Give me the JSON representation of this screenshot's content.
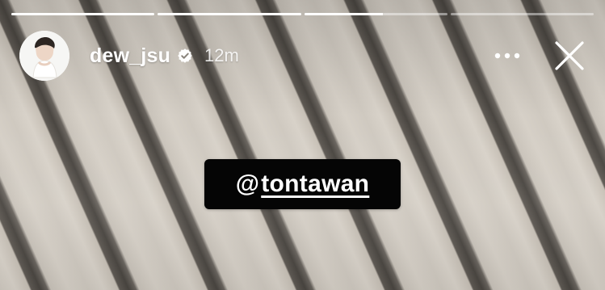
{
  "progress": [
    {
      "state": "viewed",
      "fill": 1.0
    },
    {
      "state": "viewed",
      "fill": 1.0
    },
    {
      "state": "current",
      "fill": 0.55
    },
    {
      "state": "upcoming",
      "fill": 0.0
    }
  ],
  "header": {
    "username": "dew_jsu",
    "verified_icon": "verified-badge-icon",
    "time": "12m",
    "more_icon": "more-options-icon",
    "close_icon": "close-icon"
  },
  "mention": {
    "at": "@",
    "handle": "tontawan"
  },
  "colors": {
    "text": "#ffffff",
    "sticker_bg": "#050505",
    "progress_track": "rgba(255,255,255,0.45)",
    "progress_fill": "#ffffff"
  }
}
